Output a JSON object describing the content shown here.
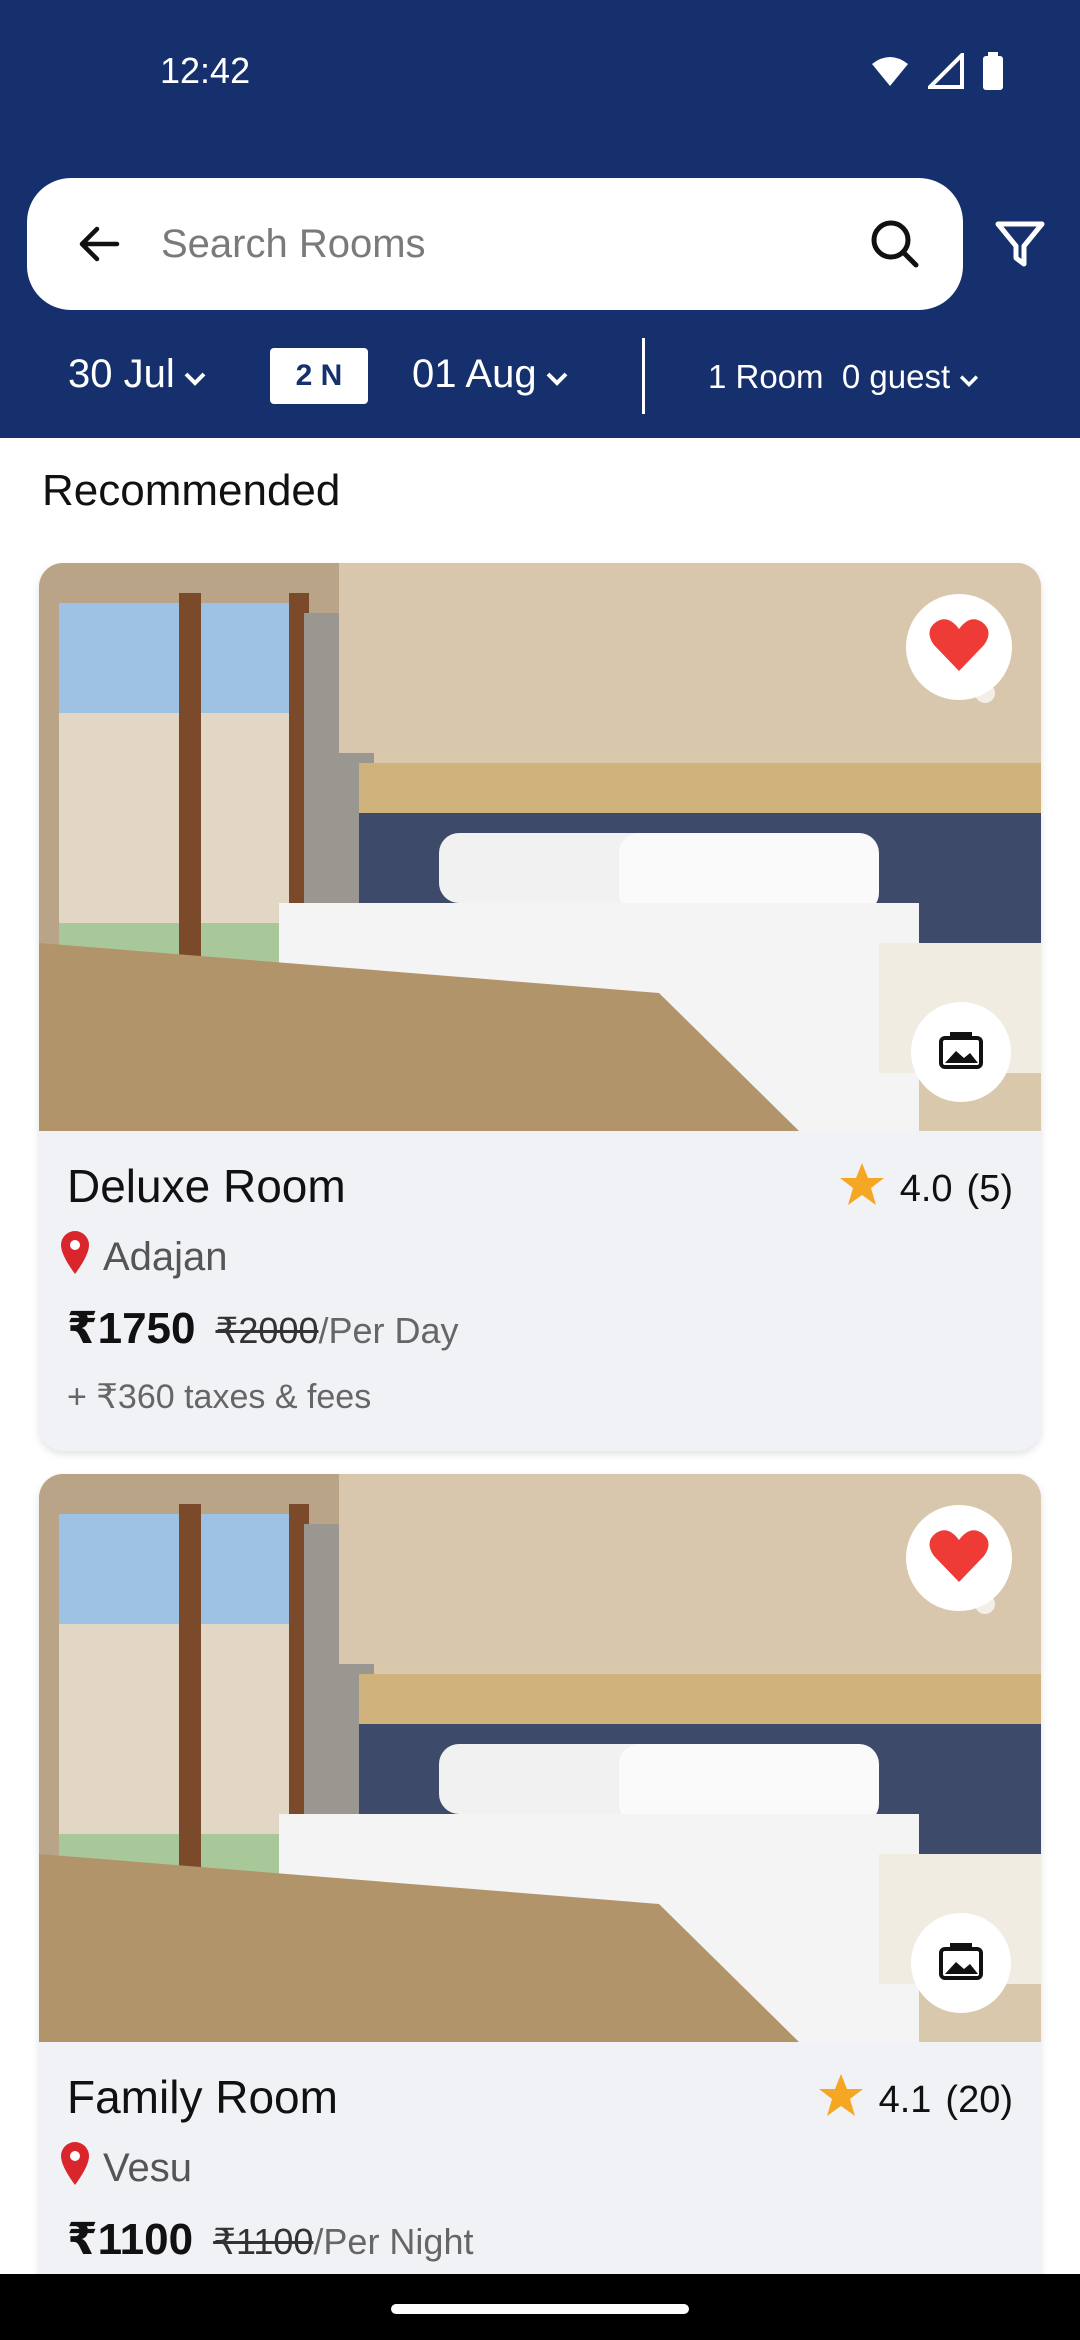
{
  "status_bar": {
    "time": "12:42"
  },
  "search": {
    "placeholder": "Search Rooms"
  },
  "dates": {
    "check_in": "30 Jul",
    "nights": "2 N",
    "check_out": "01 Aug",
    "rooms_guests": "1 Room  0 guest"
  },
  "section": {
    "title": "Recommended"
  },
  "rooms": [
    {
      "name": "Deluxe Room",
      "rating": "4.0",
      "reviews": "(5)",
      "location": "Adajan",
      "price": "₹1750",
      "old_price": "₹2000",
      "unit": "/Per Day",
      "taxes": "+ ₹360 taxes & fees"
    },
    {
      "name": "Family Room",
      "rating": "4.1",
      "reviews": "(20)",
      "location": "Vesu",
      "price": "₹1100",
      "old_price": "₹1100",
      "unit": "/Per Night"
    }
  ],
  "colors": {
    "header_bg": "#15306d",
    "favorite": "#ef3b36",
    "star": "#f5a623",
    "location_pin": "#d8262c",
    "card_bg": "#f1f2f6"
  },
  "icons": {
    "back": "arrow-left-icon",
    "search": "search-icon",
    "filter": "filter-icon",
    "favorite": "heart-icon",
    "gallery": "gallery-icon",
    "rating": "star-icon",
    "location": "location-pin-icon"
  }
}
